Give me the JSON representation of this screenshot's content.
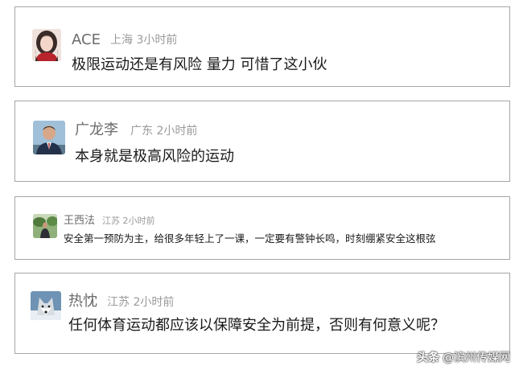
{
  "comments": [
    {
      "username": "ACE",
      "location": "上海",
      "time": "3小时前",
      "text": "极限运动还是有风险 量力 可惜了这小伙",
      "avatar_icon": "woman-avatar-icon"
    },
    {
      "username": "广龙李",
      "location": "广东",
      "time": "2小时前",
      "text": "本身就是极高风险的运动",
      "avatar_icon": "man-portrait-avatar-icon"
    },
    {
      "username": "王西法",
      "location": "江苏",
      "time": "2小时前",
      "text": "安全第一预防为主，给很多年轻上了一课，一定要有警钟长鸣，时刻绷紧安全这根弦",
      "avatar_icon": "outdoor-photo-avatar-icon"
    },
    {
      "username": "热忱",
      "location": "江苏",
      "time": "2小时前",
      "text": "任何体育运动都应该以保障安全为前提，否则有何意义呢？",
      "avatar_icon": "wolf-avatar-icon"
    }
  ],
  "watermark": {
    "brand": "头条",
    "handle": "@滨州传媒网"
  },
  "colors": {
    "card_border": "#a6a6a6",
    "username": "#6b6b6b",
    "meta": "#9a9a9a",
    "comment_text": "#1a1a1a"
  }
}
